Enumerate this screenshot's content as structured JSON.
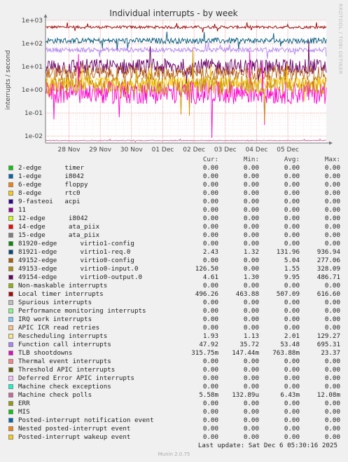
{
  "chart_data": {
    "type": "line",
    "title": "Individual interrupts - by week",
    "ylabel": "interrupts / second",
    "yscale": "log",
    "ylim": [
      0.005,
      1000
    ],
    "y_ticks": [
      "1e-02",
      "1e-01",
      "1e+00",
      "1e+01",
      "1e+02",
      "1e+03"
    ],
    "x_ticks": [
      "28 Nov",
      "29 Nov",
      "30 Nov",
      "01 Dec",
      "02 Dec",
      "03 Dec",
      "04 Dec",
      "05 Dec"
    ],
    "xlim": [
      "2025-11-27 06:00",
      "2025-12-06 05:30"
    ],
    "grid": true,
    "series": [
      {
        "name": "Local timer interrupts",
        "color": "#990000",
        "level": 507,
        "spread": 0.06
      },
      {
        "name": "81921-edge virtio1-req.0",
        "color": "#00587a",
        "level": 132,
        "spread": 0.12
      },
      {
        "name": "Function call interrupts",
        "color": "#b087f0",
        "level": 53,
        "spread": 0.1
      },
      {
        "name": "49154-edge virtio0-output.0",
        "color": "#660066",
        "level": 9.95,
        "spread": 0.35
      },
      {
        "name": "49152-edge virtio0-config",
        "color": "#b8610f",
        "level": 5.04,
        "spread": 0.3
      },
      {
        "name": "Rescheduling interrupts",
        "color": "#ffcc00",
        "level": 2.01,
        "spread": 0.25
      },
      {
        "name": "TLB shootdowns",
        "color": "#ff00cc",
        "level": 0.76,
        "spread": 0.5
      },
      {
        "name": "49153-edge virtio0-input.0",
        "color": "#cc9900",
        "level": 1.55,
        "spread": 0.4
      },
      {
        "name": "Machine check polls",
        "color": "#cc6699",
        "level": 0.0064,
        "spread": 0.02
      }
    ]
  },
  "legend": {
    "headers": [
      "Cur:",
      "Min:",
      "Avg:",
      "Max:"
    ],
    "rows": [
      {
        "label": "2-edge      timer",
        "color": "#00cc00",
        "cur": "0.00",
        "min": "0.00",
        "avg": "0.00",
        "max": "0.00"
      },
      {
        "label": "1-edge      i8042",
        "color": "#0066b3",
        "cur": "0.00",
        "min": "0.00",
        "avg": "0.00",
        "max": "0.00"
      },
      {
        "label": "6-edge      floppy",
        "color": "#ff8000",
        "cur": "0.00",
        "min": "0.00",
        "avg": "0.00",
        "max": "0.00"
      },
      {
        "label": "8-edge      rtc0",
        "color": "#ffcc00",
        "cur": "0.00",
        "min": "0.00",
        "avg": "0.00",
        "max": "0.00"
      },
      {
        "label": "9-fasteoi   acpi",
        "color": "#330099",
        "cur": "0.00",
        "min": "0.00",
        "avg": "0.00",
        "max": "0.00"
      },
      {
        "label": "11",
        "color": "#990099",
        "cur": "0.00",
        "min": "0.00",
        "avg": "0.00",
        "max": "0.00"
      },
      {
        "label": "12-edge      i8042",
        "color": "#ccff00",
        "cur": "0.00",
        "min": "0.00",
        "avg": "0.00",
        "max": "0.00"
      },
      {
        "label": "14-edge      ata_piix",
        "color": "#ff0000",
        "cur": "0.00",
        "min": "0.00",
        "avg": "0.00",
        "max": "0.00"
      },
      {
        "label": "15-edge      ata_piix",
        "color": "#808080",
        "cur": "0.00",
        "min": "0.00",
        "avg": "0.00",
        "max": "0.00"
      },
      {
        "label": "81920-edge      virtio1-config",
        "color": "#008f00",
        "cur": "0.00",
        "min": "0.00",
        "avg": "0.00",
        "max": "0.00"
      },
      {
        "label": "81921-edge      virtio1-req.0",
        "color": "#00487d",
        "cur": "2.43",
        "min": "1.32",
        "avg": "131.96",
        "max": "936.94"
      },
      {
        "label": "49152-edge      virtio0-config",
        "color": "#b35a00",
        "cur": "0.00",
        "min": "0.00",
        "avg": "5.04",
        "max": "277.06"
      },
      {
        "label": "49153-edge      virtio0-input.0",
        "color": "#b38f00",
        "cur": "126.50",
        "min": "0.00",
        "avg": "1.55",
        "max": "328.09"
      },
      {
        "label": "49154-edge      virtio0-output.0",
        "color": "#6b006b",
        "cur": "4.61",
        "min": "1.30",
        "avg": "9.95",
        "max": "486.71"
      },
      {
        "label": "Non-maskable interrupts",
        "color": "#8fb300",
        "cur": "0.00",
        "min": "0.00",
        "avg": "0.00",
        "max": "0.00"
      },
      {
        "label": "Local timer interrupts",
        "color": "#b30000",
        "cur": "496.26",
        "min": "463.88",
        "avg": "507.09",
        "max": "616.60"
      },
      {
        "label": "Spurious interrupts",
        "color": "#bebebe",
        "cur": "0.00",
        "min": "0.00",
        "avg": "0.00",
        "max": "0.00"
      },
      {
        "label": "Performance monitoring interrupts",
        "color": "#80ff80",
        "cur": "0.00",
        "min": "0.00",
        "avg": "0.00",
        "max": "0.00"
      },
      {
        "label": "IRQ work interrupts",
        "color": "#80c9ff",
        "cur": "0.00",
        "min": "0.00",
        "avg": "0.00",
        "max": "0.00"
      },
      {
        "label": "APIC ICR read retries",
        "color": "#ffc080",
        "cur": "0.00",
        "min": "0.00",
        "avg": "0.00",
        "max": "0.00"
      },
      {
        "label": "Rescheduling interrupts",
        "color": "#ffe680",
        "cur": "1.93",
        "min": "1.13",
        "avg": "2.01",
        "max": "129.27"
      },
      {
        "label": "Function call interrupts",
        "color": "#aa80ff",
        "cur": "47.92",
        "min": "35.72",
        "avg": "53.48",
        "max": "695.31"
      },
      {
        "label": "TLB shootdowns",
        "color": "#ee00cc",
        "cur": "315.75m",
        "min": "147.44m",
        "avg": "763.88m",
        "max": "23.37"
      },
      {
        "label": "Thermal event interrupts",
        "color": "#ff8080",
        "cur": "0.00",
        "min": "0.00",
        "avg": "0.00",
        "max": "0.00"
      },
      {
        "label": "Threshold APIC interrupts",
        "color": "#666600",
        "cur": "0.00",
        "min": "0.00",
        "avg": "0.00",
        "max": "0.00"
      },
      {
        "label": "Deferred Error APIC interrupts",
        "color": "#ffbfff",
        "cur": "0.00",
        "min": "0.00",
        "avg": "0.00",
        "max": "0.00"
      },
      {
        "label": "Machine check exceptions",
        "color": "#00ffcc",
        "cur": "0.00",
        "min": "0.00",
        "avg": "0.00",
        "max": "0.00"
      },
      {
        "label": "Machine check polls",
        "color": "#cc6699",
        "cur": "5.58m",
        "min": "132.89u",
        "avg": "6.43m",
        "max": "12.08m"
      },
      {
        "label": "ERR",
        "color": "#999900",
        "cur": "0.00",
        "min": "0.00",
        "avg": "0.00",
        "max": "0.00"
      },
      {
        "label": "MIS",
        "color": "#00cc00",
        "cur": "0.00",
        "min": "0.00",
        "avg": "0.00",
        "max": "0.00"
      },
      {
        "label": "Posted-interrupt notification event",
        "color": "#0066b3",
        "cur": "0.00",
        "min": "0.00",
        "avg": "0.00",
        "max": "0.00"
      },
      {
        "label": "Nested posted-interrupt event",
        "color": "#ff8000",
        "cur": "0.00",
        "min": "0.00",
        "avg": "0.00",
        "max": "0.00"
      },
      {
        "label": "Posted-interrupt wakeup event",
        "color": "#ffcc00",
        "cur": "0.00",
        "min": "0.00",
        "avg": "0.00",
        "max": "0.00"
      }
    ]
  },
  "side_label": "RRDTOOL / TOBI OETIKER",
  "footer": "Last update: Sat Dec  6 05:30:16 2025",
  "version": "Munin 2.0.75"
}
